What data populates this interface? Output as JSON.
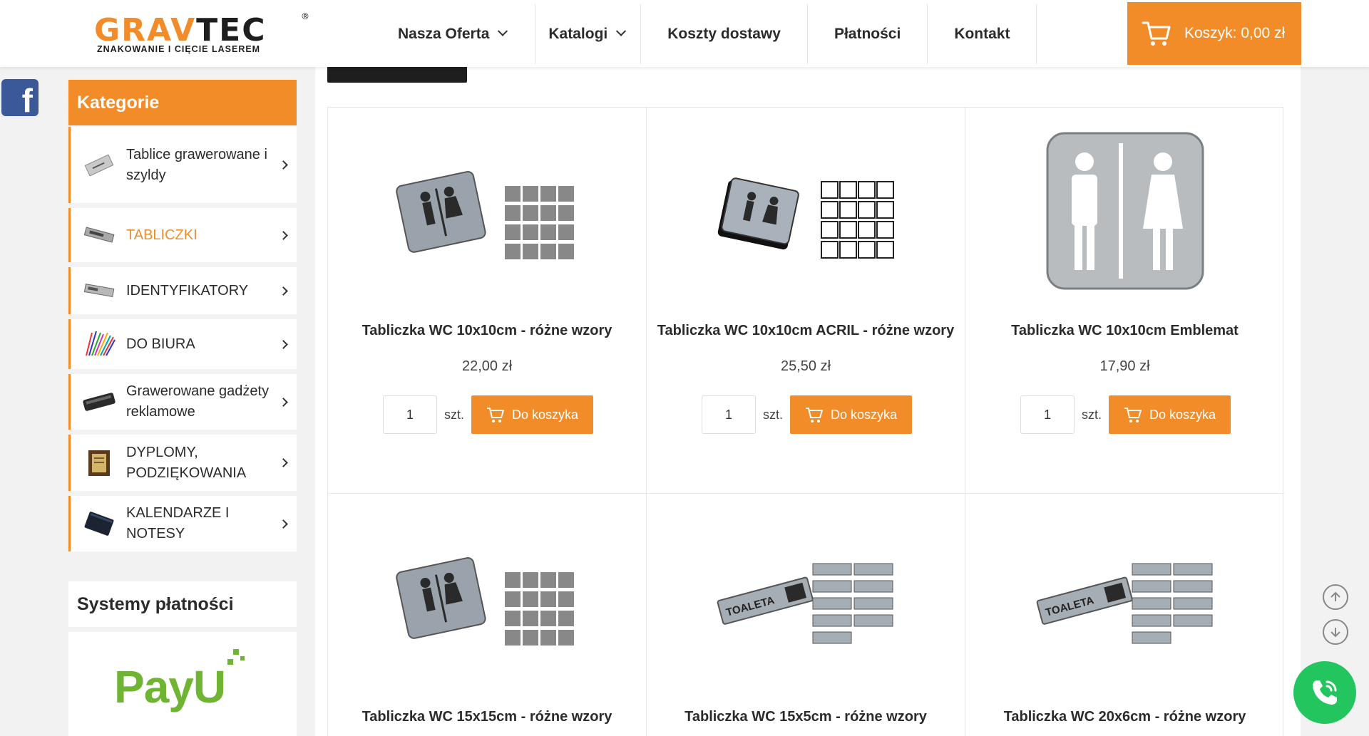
{
  "header": {
    "logo": {
      "part1": "GRAV",
      "part2": "TEC",
      "registered": "®",
      "tagline": "ZNAKOWANIE I CIĘCIE LASEREM"
    },
    "nav": [
      {
        "label": "Nasza Oferta",
        "dropdown": true
      },
      {
        "label": "Katalogi",
        "dropdown": true
      },
      {
        "label": "Koszty dostawy",
        "dropdown": false
      },
      {
        "label": "Płatności",
        "dropdown": false
      },
      {
        "label": "Kontakt",
        "dropdown": false
      }
    ],
    "cart": {
      "label": "Koszyk: 0,00 zł",
      "icon": "cart-icon"
    }
  },
  "social": {
    "facebook": "f"
  },
  "sidebar": {
    "title": "Kategorie",
    "items": [
      {
        "label": "Tablice grawerowane i szyldy",
        "active": false
      },
      {
        "label": "TABLICZKI",
        "active": true
      },
      {
        "label": "IDENTYFIKATORY",
        "active": false
      },
      {
        "label": "DO BIURA",
        "active": false
      },
      {
        "label": "Grawerowane gadżety reklamowe",
        "active": false
      },
      {
        "label": "DYPLOMY, PODZIĘKOWANIA",
        "active": false
      },
      {
        "label": "KALENDARZE I NOTESY",
        "active": false
      }
    ],
    "payments_title": "Systemy płatności",
    "payu": "PayU"
  },
  "products": [
    {
      "title": "Tabliczka WC 10x10cm - różne wzory",
      "price": "22,00 zł",
      "qty": "1",
      "unit": "szt.",
      "button": "Do koszyka"
    },
    {
      "title": "Tabliczka WC 10x10cm ACRIL - różne wzory",
      "price": "25,50 zł",
      "qty": "1",
      "unit": "szt.",
      "button": "Do koszyka"
    },
    {
      "title": "Tabliczka WC 10x10cm Emblemat",
      "price": "17,90 zł",
      "qty": "1",
      "unit": "szt.",
      "button": "Do koszyka"
    },
    {
      "title": "Tabliczka WC 15x15cm - różne wzory"
    },
    {
      "title": "Tabliczka WC 15x5cm - różne wzory"
    },
    {
      "title": "Tabliczka WC 20x6cm - różne wzory"
    }
  ],
  "colors": {
    "accent": "#f28c28",
    "facebook": "#3b5998",
    "phone": "#22c55e",
    "payu": "#6fb432"
  }
}
